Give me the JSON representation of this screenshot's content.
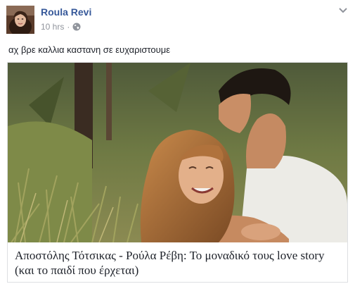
{
  "post": {
    "author": "Roula Revi",
    "timestamp": "10 hrs",
    "separator": "·",
    "privacy_icon": "globe-icon",
    "menu_icon": "chevron-down-icon",
    "text": "αχ βρε καλλια καστανη σε ευχαριστουμε"
  },
  "link": {
    "title": "Αποστόλης Τότσικας - Ρούλα Ρέβη: Το μοναδικό τους love story (και το παιδί που έρχεται)"
  },
  "colors": {
    "author": "#365899",
    "meta": "#90949c",
    "text": "#1d2129",
    "border": "#dddfe2"
  }
}
